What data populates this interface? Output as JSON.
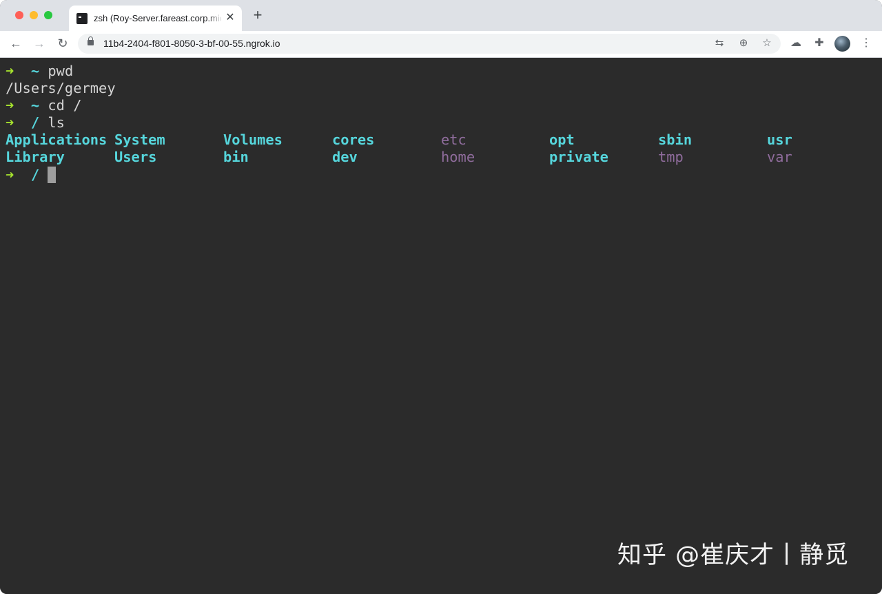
{
  "browser": {
    "tab": {
      "title": "zsh (Roy-Server.fareast.corp.microsoft.com)",
      "favicon": "terminal-icon"
    },
    "new_tab_label": "+",
    "nav": {
      "back": "←",
      "forward": "→",
      "reload": "↻"
    },
    "url": "11b4-2404-f801-8050-3-bf-00-55.ngrok.io",
    "icons": [
      "translate-icon",
      "zoom-icon",
      "star-icon",
      "cloud-icon",
      "extensions-icon",
      "profile-avatar",
      "menu-icon"
    ],
    "glyphs": {
      "translate": "⇆",
      "zoom": "⊕",
      "star": "☆",
      "cloud": "☁",
      "extensions": "✚",
      "menu": "⋮",
      "close": "✕"
    }
  },
  "terminal": {
    "prompt_arrow": "➜",
    "lines": [
      {
        "cwd": "~",
        "cmd": "pwd"
      },
      {
        "output": "/Users/germey"
      },
      {
        "cwd": "~",
        "cmd": "cd /"
      },
      {
        "cwd": "/",
        "cmd": "ls"
      }
    ],
    "ls_rows": [
      [
        {
          "name": "Applications",
          "kind": "dir"
        },
        {
          "name": "System",
          "kind": "dir"
        },
        {
          "name": "Volumes",
          "kind": "dir"
        },
        {
          "name": "cores",
          "kind": "dir"
        },
        {
          "name": "etc",
          "kind": "link"
        },
        {
          "name": "opt",
          "kind": "dir"
        },
        {
          "name": "sbin",
          "kind": "dir"
        },
        {
          "name": "usr",
          "kind": "dir"
        }
      ],
      [
        {
          "name": "Library",
          "kind": "dir"
        },
        {
          "name": "Users",
          "kind": "dir"
        },
        {
          "name": "bin",
          "kind": "dir"
        },
        {
          "name": "dev",
          "kind": "dir"
        },
        {
          "name": "home",
          "kind": "link"
        },
        {
          "name": "private",
          "kind": "dir"
        },
        {
          "name": "tmp",
          "kind": "link"
        },
        {
          "name": "var",
          "kind": "link"
        }
      ]
    ],
    "current_prompt": {
      "cwd": "/"
    },
    "colors": {
      "arrow": "#a6e22e",
      "dir": "#56d6dc",
      "link": "#8f6c9c",
      "text": "#d4d4d4",
      "background": "#2b2b2b"
    }
  },
  "watermark": "知乎 @崔庆才丨静觅"
}
